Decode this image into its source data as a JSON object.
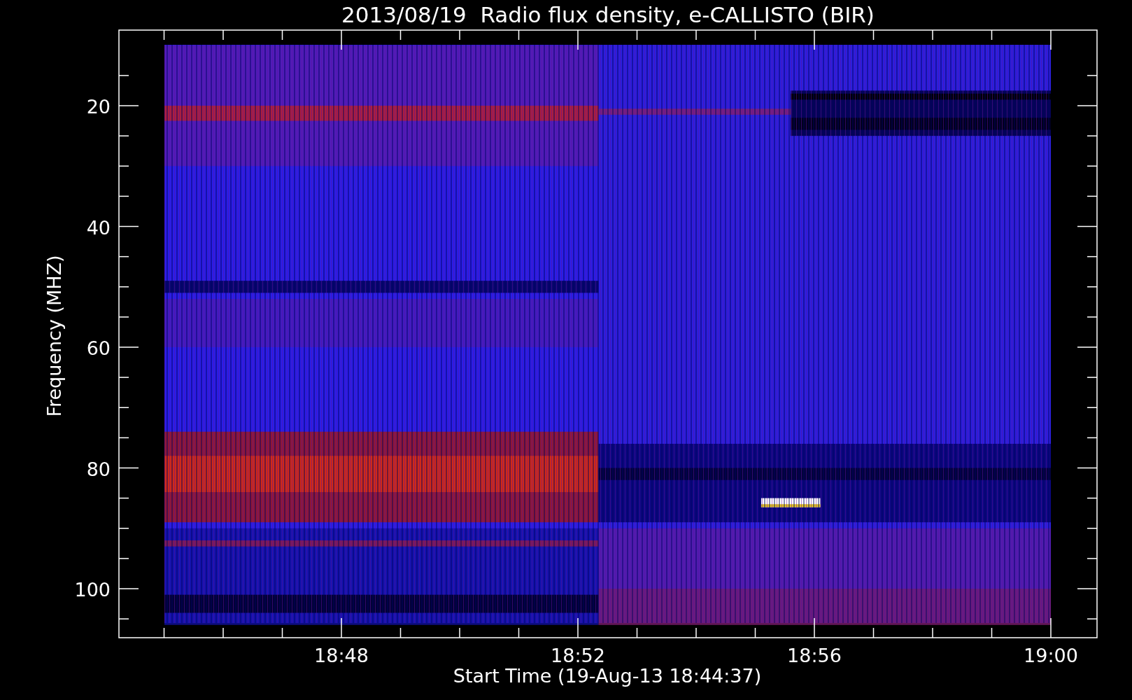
{
  "plot": {
    "title": "2013/08/19  Radio flux density, e-CALLISTO (BIR)",
    "ylabel": "Frequency (MHZ)",
    "xlabel": "Start Time (19-Aug-13 18:44:37)",
    "y_tick_labels": [
      "20",
      "40",
      "60",
      "80",
      "100"
    ],
    "x_tick_labels": [
      "18:48",
      "18:52",
      "18:56",
      "19:00"
    ]
  }
}
